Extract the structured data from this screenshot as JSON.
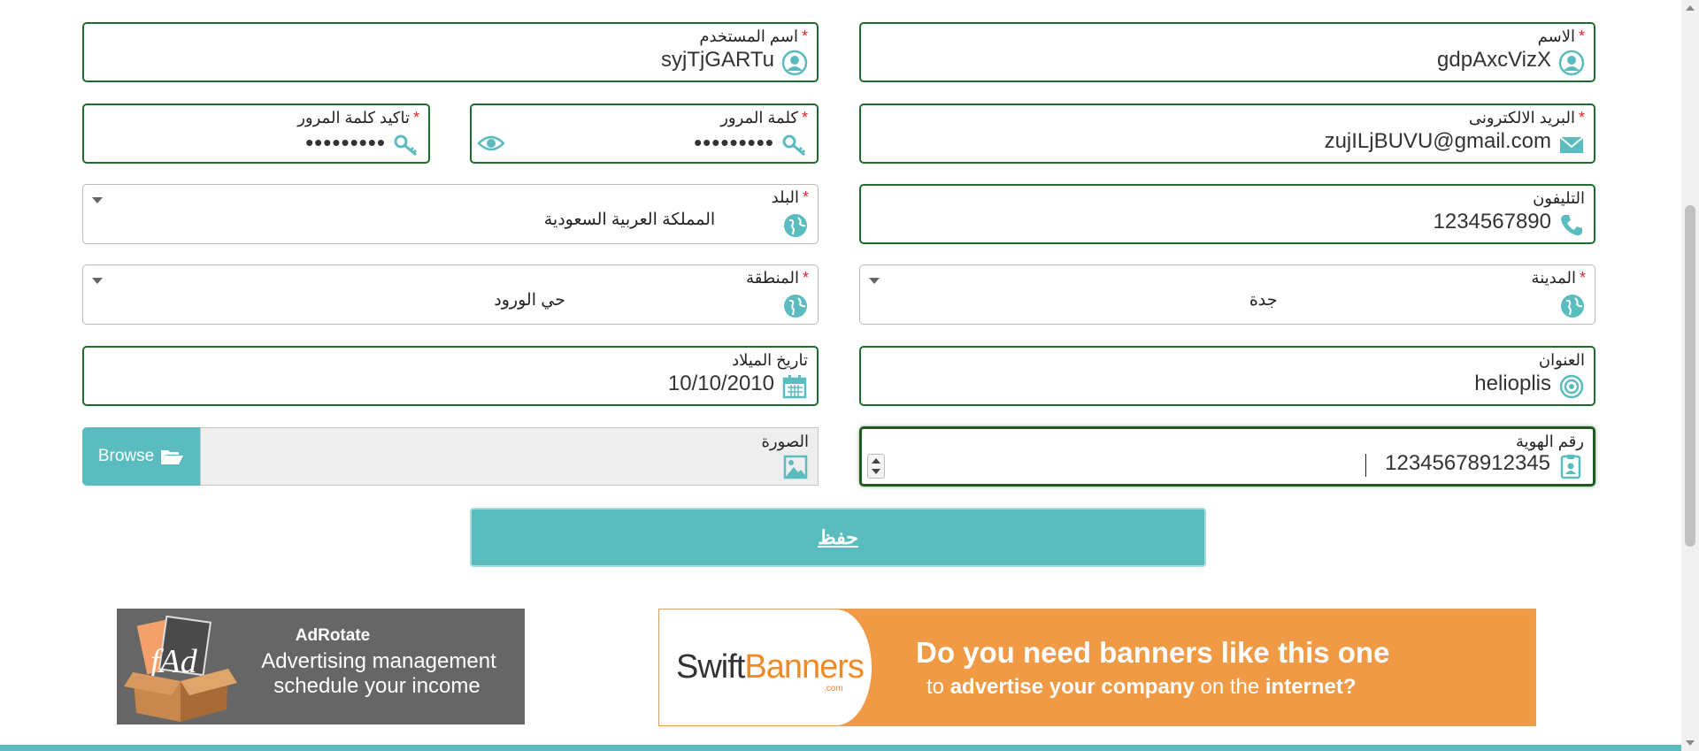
{
  "form": {
    "name": {
      "label": "الاسم",
      "required": "*",
      "value": "gdpAxcVizX"
    },
    "username": {
      "label": "اسم المستخدم",
      "required": "*",
      "value": "syjTjGARTu"
    },
    "email": {
      "label": "البريد الالكترونى",
      "required": "*",
      "value": "zujILjBUVU@gmail.com"
    },
    "password": {
      "label": "كلمة المرور",
      "required": "*",
      "value": "•••••••••"
    },
    "confirm_password": {
      "label": "تاكيد كلمة المرور",
      "required": "*",
      "value": "•••••••••"
    },
    "phone": {
      "label": "التليفون",
      "value": "1234567890"
    },
    "country": {
      "label": "البلد",
      "required": "*",
      "value": "المملكة العربية السعودية"
    },
    "city": {
      "label": "المدينة",
      "required": "*",
      "value": "جدة"
    },
    "region": {
      "label": "المنطقة",
      "required": "*",
      "value": "حي الورود"
    },
    "address": {
      "label": "العنوان",
      "value": "helioplis"
    },
    "birthdate": {
      "label": "تاريخ الميلاد",
      "value": "10/10/2010"
    },
    "id_number": {
      "label": "رقم الهوية",
      "value": "12345678912345"
    },
    "photo": {
      "label": "الصورة",
      "browse_label": "Browse"
    },
    "save_label": "حفظ"
  },
  "ads": {
    "adrotate": {
      "title": "AdRotate",
      "line1": "Advertising management",
      "line2": "schedule your income"
    },
    "swift": {
      "brand_a": "Swift",
      "brand_b": "Banners",
      "brand_com": ".com",
      "headline": "Do you need banners like this one",
      "sub_1": "to",
      "sub_2": "advertise your company",
      "sub_3": "on the",
      "sub_4": "internet?"
    }
  },
  "colors": {
    "accent": "#5bbcbf",
    "field_border": "#1f6b2c",
    "required": "#e3242b",
    "icon": "#5bbcbf",
    "ad_orange": "#f09a45"
  }
}
